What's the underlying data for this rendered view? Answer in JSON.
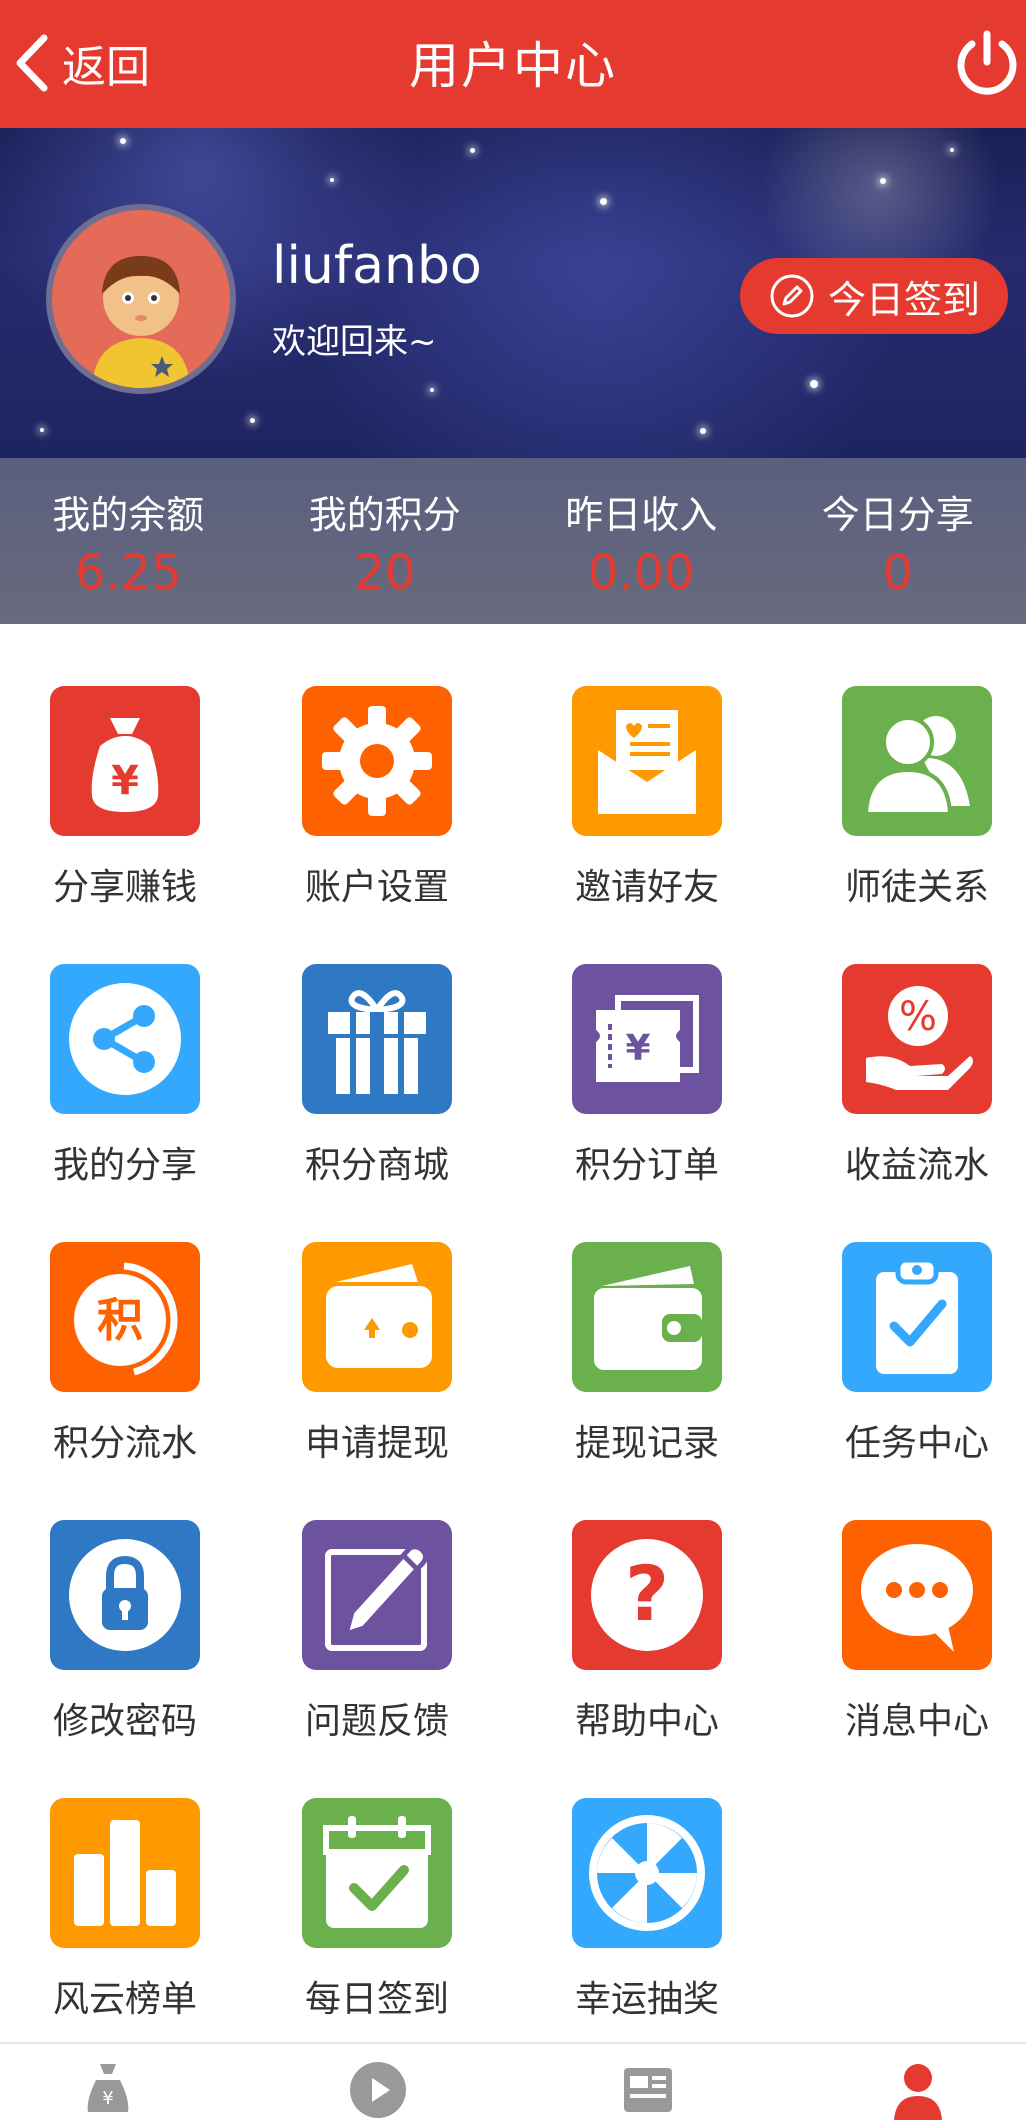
{
  "header": {
    "back_label": "返回",
    "title": "用户中心"
  },
  "profile": {
    "username": "liufanbo",
    "welcome": "欢迎回来~",
    "checkin_label": "今日签到"
  },
  "stats": [
    {
      "label": "我的余额",
      "value": "6.25"
    },
    {
      "label": "我的积分",
      "value": "20"
    },
    {
      "label": "昨日收入",
      "value": "0.00"
    },
    {
      "label": "今日分享",
      "value": "0"
    }
  ],
  "menu": [
    {
      "label": "分享赚钱",
      "icon": "money-bag-icon",
      "color": "#e53a30"
    },
    {
      "label": "账户设置",
      "icon": "gear-icon",
      "color": "#fe6100"
    },
    {
      "label": "邀请好友",
      "icon": "invite-letter-icon",
      "color": "#fe9a00"
    },
    {
      "label": "师徒关系",
      "icon": "users-icon",
      "color": "#6ab04c"
    },
    {
      "label": "我的分享",
      "icon": "share-icon",
      "color": "#33a8fd"
    },
    {
      "label": "积分商城",
      "icon": "gift-icon",
      "color": "#2f78c4"
    },
    {
      "label": "积分订单",
      "icon": "ticket-icon",
      "color": "#6d52a0"
    },
    {
      "label": "收益流水",
      "icon": "hand-percent-icon",
      "color": "#e53a30"
    },
    {
      "label": "积分流水",
      "icon": "points-icon",
      "color": "#fe6100"
    },
    {
      "label": "申请提现",
      "icon": "withdraw-wallet-icon",
      "color": "#fe9a00"
    },
    {
      "label": "提现记录",
      "icon": "wallet-icon",
      "color": "#6ab04c"
    },
    {
      "label": "任务中心",
      "icon": "clipboard-check-icon",
      "color": "#33a8fd"
    },
    {
      "label": "修改密码",
      "icon": "lock-icon",
      "color": "#2f78c4"
    },
    {
      "label": "问题反馈",
      "icon": "edit-pencil-icon",
      "color": "#6d52a0"
    },
    {
      "label": "帮助中心",
      "icon": "question-icon",
      "color": "#e53a30"
    },
    {
      "label": "消息中心",
      "icon": "chat-bubble-icon",
      "color": "#fe6100"
    },
    {
      "label": "风云榜单",
      "icon": "bar-chart-icon",
      "color": "#fe9a00"
    },
    {
      "label": "每日签到",
      "icon": "calendar-check-icon",
      "color": "#6ab04c"
    },
    {
      "label": "幸运抽奖",
      "icon": "lucky-wheel-icon",
      "color": "#33a8fd"
    }
  ],
  "bottom_nav": [
    "money-bag-tab-icon",
    "video-play-tab-icon",
    "news-tab-icon",
    "user-tab-icon"
  ],
  "colors": {
    "accent": "#e53a30"
  }
}
